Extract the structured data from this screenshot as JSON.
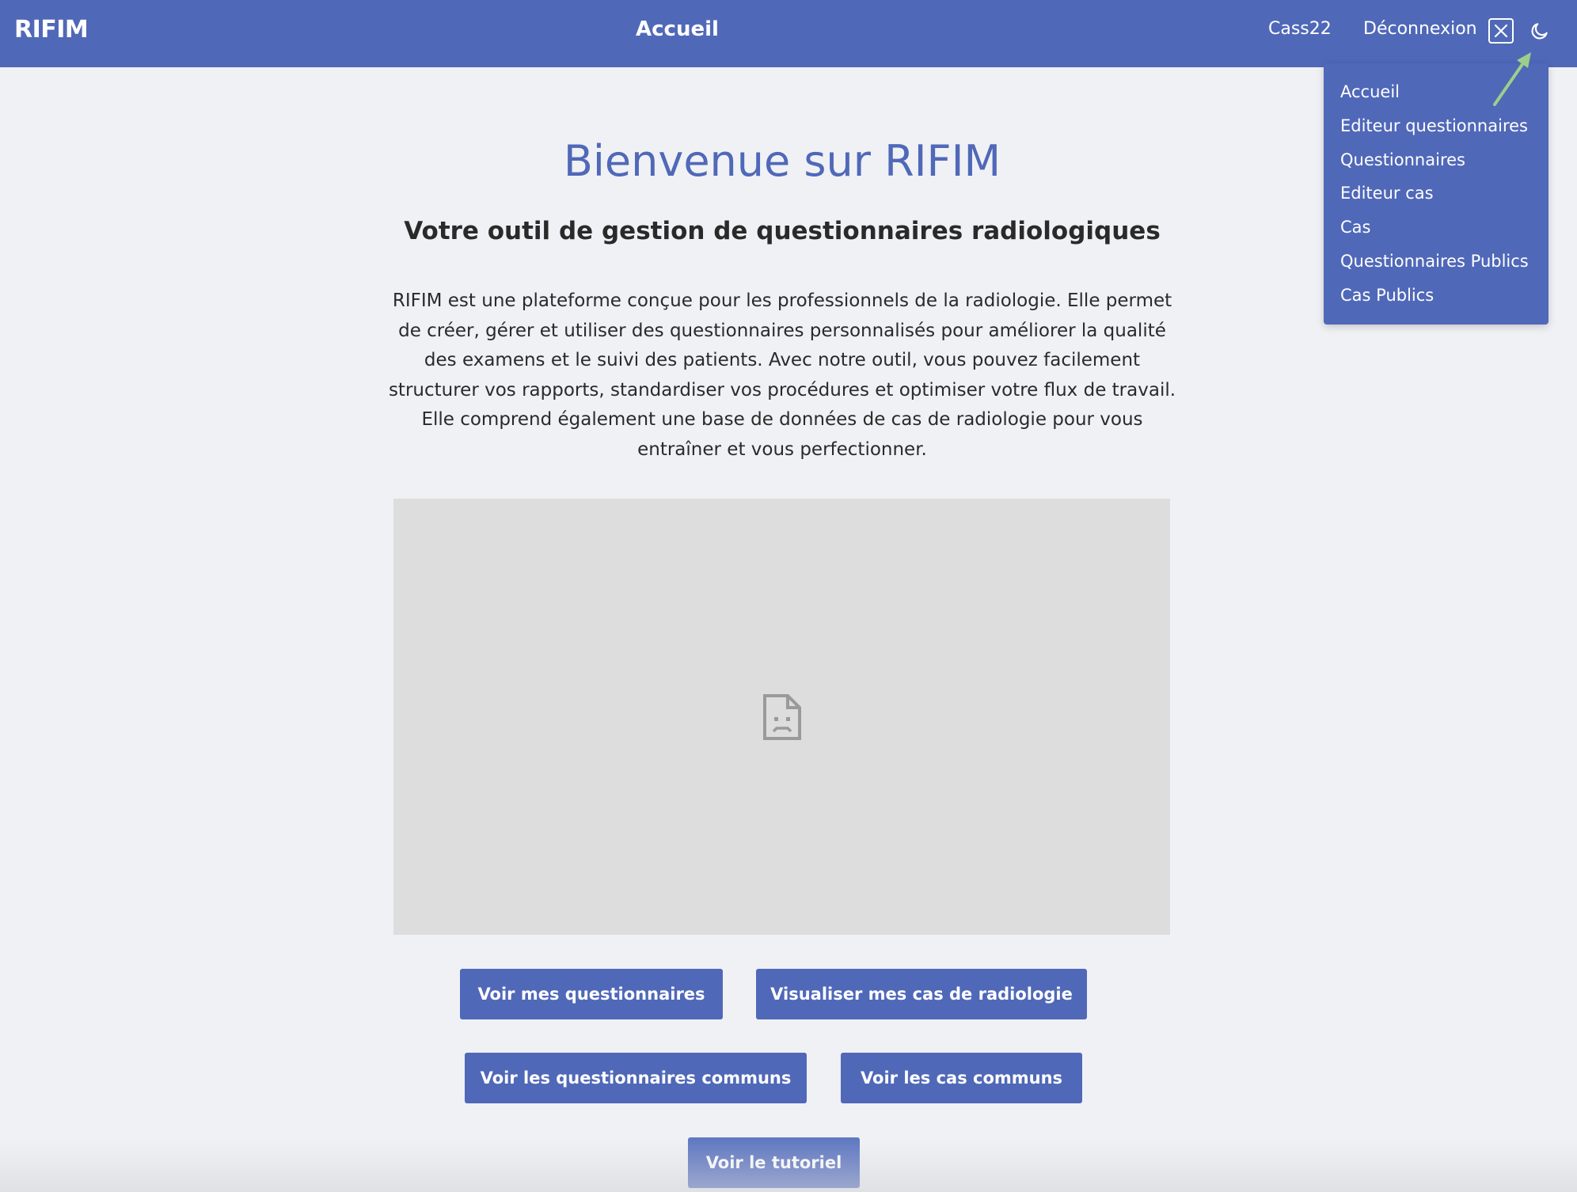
{
  "header": {
    "brand": "RIFIM",
    "title": "Accueil",
    "user": "Cass22",
    "logout": "Déconnexion",
    "close_icon": "close-icon",
    "theme_icon": "moon-icon"
  },
  "menu": {
    "items": [
      {
        "label": "Accueil"
      },
      {
        "label": "Editeur questionnaires"
      },
      {
        "label": "Questionnaires"
      },
      {
        "label": "Editeur cas"
      },
      {
        "label": "Cas"
      },
      {
        "label": "Questionnaires Publics"
      },
      {
        "label": "Cas Publics"
      }
    ]
  },
  "main": {
    "title": "Bienvenue sur RIFIM",
    "subtitle": "Votre outil de gestion de questionnaires radiologiques",
    "description": "RIFIM est une plateforme conçue pour les professionnels de la radiologie. Elle permet de créer, gérer et utiliser des questionnaires personnalisés pour améliorer la qualité des examens et le suivi des patients. Avec notre outil, vous pouvez facilement structurer vos rapports, standardiser vos procédures et optimiser votre flux de travail. Elle comprend également une base de données de cas de radiologie pour vous entraîner et vous perfectionner.",
    "media_icon": "broken-image-icon"
  },
  "buttons": {
    "my_questionnaires": "Voir mes questionnaires",
    "my_cases": "Visualiser mes cas de radiologie",
    "common_questionnaires": "Voir les questionnaires communs",
    "common_cases": "Voir les cas communs",
    "tutorial": "Voir le tutoriel"
  },
  "colors": {
    "primary": "#5068b8",
    "background": "#f0f1f5",
    "annotation_arrow": "#9ccf8a"
  }
}
